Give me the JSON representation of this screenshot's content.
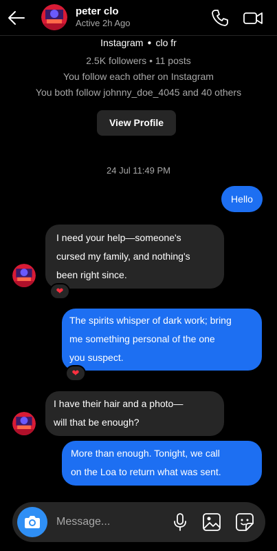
{
  "header": {
    "name": "peter clo",
    "status": "Active 2h Ago"
  },
  "profile": {
    "platform": "Instagram",
    "username": "clo fr",
    "stats": "2.5K followers • 11 posts",
    "mutual": "You follow each other on Instagram",
    "both_follow": "You both follow  johnny_doe_4045 and  40 others",
    "view_profile": "View Profile"
  },
  "timestamp": "24 Jul 11:49 PM",
  "messages": [
    {
      "from": "me",
      "text": "Hello"
    },
    {
      "from": "them",
      "lines": [
        "I need your help—someone's",
        "cursed my family, and nothing's",
        "been right since."
      ],
      "reaction": "heart"
    },
    {
      "from": "me",
      "lines": [
        "The spirits whisper of dark work; bring",
        "me something personal of the one",
        "you suspect."
      ],
      "reaction": "heart"
    },
    {
      "from": "them",
      "lines": [
        "I have their hair and a photo—",
        "will that be enough?"
      ]
    },
    {
      "from": "me",
      "lines": [
        "More than enough. Tonight, we call",
        "on the Loa to return what was sent."
      ]
    }
  ],
  "composer": {
    "placeholder": "Message..."
  },
  "colors": {
    "outgoing_bubble": "#1d6ff2",
    "incoming_bubble": "#262626",
    "camera_button": "#2f8ff5",
    "heart": "#ff3040"
  }
}
